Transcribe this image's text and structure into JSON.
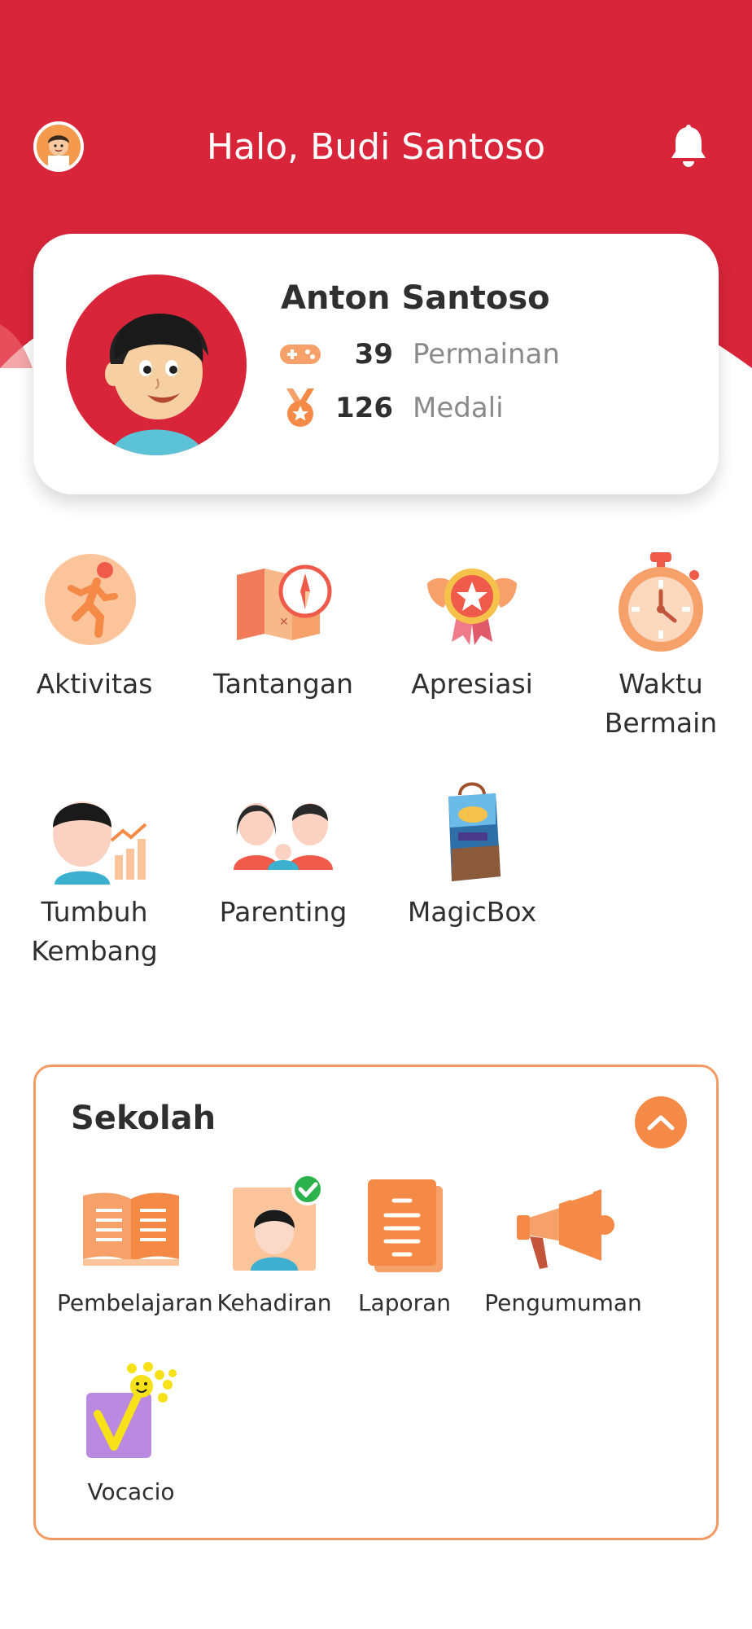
{
  "header": {
    "greeting": "Halo, Budi Santoso",
    "bg_color": "#d9253a",
    "avatar_icon": "parent-avatar-icon",
    "notification_icon": "bell-icon"
  },
  "child_profile": {
    "name": "Anton Santoso",
    "stats": [
      {
        "icon": "gamepad-icon",
        "value": "39",
        "label": "Permainan"
      },
      {
        "icon": "medal-icon",
        "value": "126",
        "label": "Medali"
      }
    ]
  },
  "menu": {
    "items": [
      {
        "label": "Aktivitas",
        "icon": "running-person-icon"
      },
      {
        "label": "Tantangan",
        "icon": "map-compass-icon"
      },
      {
        "label": "Apresiasi",
        "icon": "winged-star-badge-icon"
      },
      {
        "label": "Waktu Bermain",
        "icon": "stopwatch-icon"
      },
      {
        "label": "Tumbuh Kembang",
        "icon": "growth-chart-icon"
      },
      {
        "label": "Parenting",
        "icon": "family-icon"
      },
      {
        "label": "MagicBox",
        "icon": "magicbox-bag-icon"
      }
    ]
  },
  "school": {
    "title": "Sekolah",
    "collapse_icon": "chevron-up-icon",
    "accent_color": "#f58a47",
    "items": [
      {
        "label": "Pembelajaran",
        "icon": "open-book-icon"
      },
      {
        "label": "Kehadiran",
        "icon": "attendance-check-icon"
      },
      {
        "label": "Laporan",
        "icon": "report-document-icon"
      },
      {
        "label": "Pengumuman",
        "icon": "megaphone-icon"
      },
      {
        "label": "Vocacio",
        "icon": "vocacio-logo-icon"
      }
    ]
  }
}
